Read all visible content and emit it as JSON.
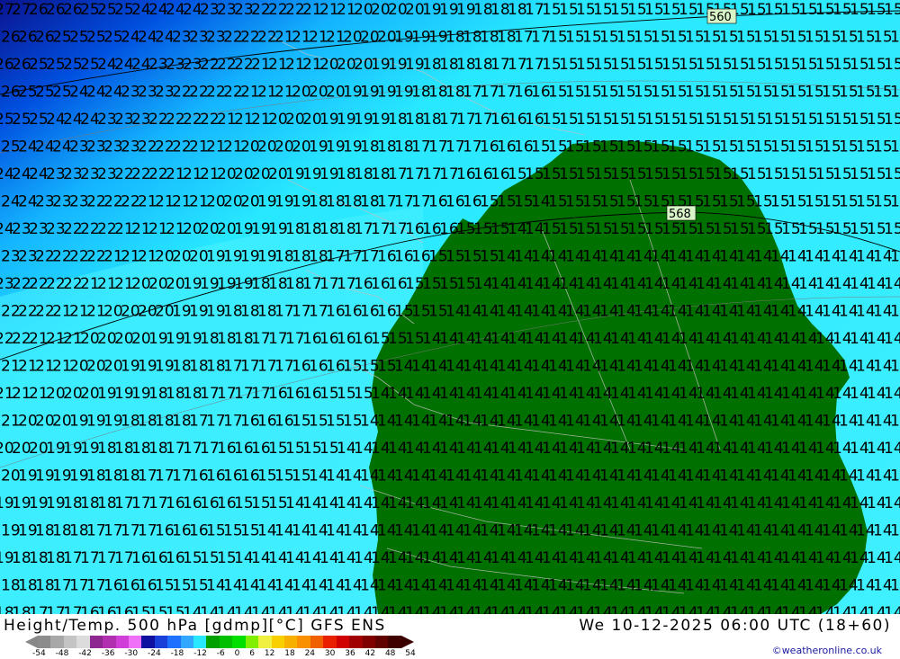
{
  "map": {
    "title": "Height/Temp. 500 hPa [gdmp][°C] GFS ENS",
    "valid_time": "We 10-12-2025 06:00 UTC (18+60)",
    "credit": "©weatheronline.co.uk",
    "contour_labels": [
      "560",
      "568"
    ],
    "temperature_labels": [
      "27",
      "26",
      "25",
      "24",
      "23",
      "22",
      "21",
      "20",
      "19",
      "18",
      "17",
      "16",
      "15",
      "14"
    ],
    "colors": {
      "ocean_cyan": "#28e8ff",
      "light_cyan": "#5ff4ff",
      "mid_blue": "#14b4ff",
      "deep_blue": "#0050e0",
      "dark_blue": "#1010a0",
      "land_green": "#007000",
      "border_grey": "#bfbfbf"
    },
    "legend": {
      "ticks": [
        "-54",
        "-48",
        "-42",
        "-36",
        "-30",
        "-24",
        "-18",
        "-12",
        "-6",
        "0",
        "6",
        "12",
        "18",
        "24",
        "30",
        "36",
        "42",
        "48",
        "54"
      ],
      "colors": [
        "#8c8c8c",
        "#a8a8a8",
        "#c4c4c4",
        "#dcdcdc",
        "#8e2890",
        "#b030b0",
        "#d040d8",
        "#f070f8",
        "#1010a0",
        "#1840d8",
        "#2070ff",
        "#30a8ff",
        "#28e8ff",
        "#00a000",
        "#00c000",
        "#00e000",
        "#80f000",
        "#f0f040",
        "#f8d000",
        "#f8b000",
        "#f89000",
        "#f06000",
        "#e82000",
        "#d00000",
        "#a00000",
        "#800000",
        "#600000",
        "#400000"
      ]
    }
  }
}
